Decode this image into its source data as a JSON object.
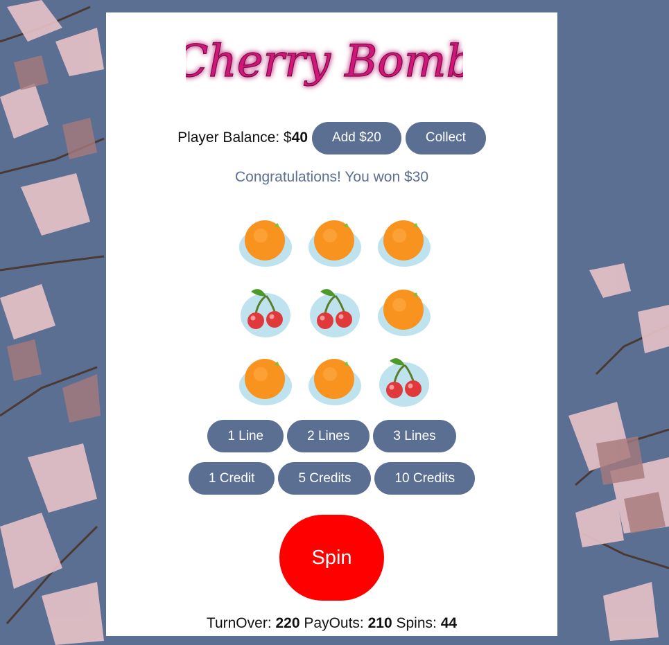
{
  "app": {
    "logo_text": "Cherry Bomb"
  },
  "colors": {
    "accent": "#5b6f93",
    "spin": "#ff0000",
    "logo": "#d0157a"
  },
  "balance": {
    "label": "Player Balance: $",
    "value": "40",
    "add_button": "Add $20",
    "collect_button": "Collect"
  },
  "message": "Congratulations! You won $30",
  "reels": [
    [
      "orange-icon",
      "orange-icon",
      "orange-icon"
    ],
    [
      "cherry-icon",
      "cherry-icon",
      "orange-icon"
    ],
    [
      "orange-icon",
      "orange-icon",
      "cherry-icon"
    ]
  ],
  "lines": {
    "one": "1 Line",
    "two": "2 Lines",
    "three": "3 Lines"
  },
  "credits": {
    "one": "1 Credit",
    "five": "5 Credits",
    "ten": "10 Credits"
  },
  "spin_label": "Spin",
  "stats": {
    "turnover_label": "TurnOver:",
    "turnover": "220",
    "payouts_label": "PayOuts:",
    "payouts": "210",
    "spins_label": "Spins:",
    "spins": "44"
  }
}
